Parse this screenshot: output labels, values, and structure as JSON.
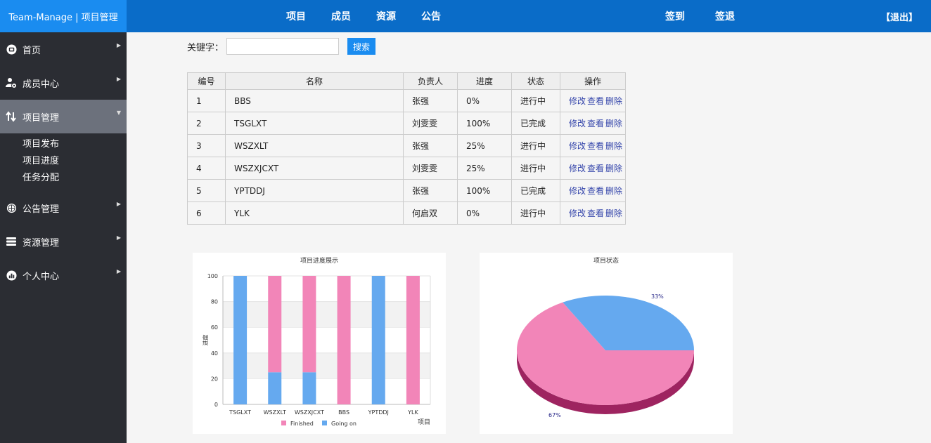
{
  "header": {
    "brand": "Team-Manage | 项目管理",
    "nav": [
      "项目",
      "成员",
      "资源",
      "公告"
    ],
    "sign_in": "签到",
    "sign_out": "签退",
    "logout": "【退出】"
  },
  "sidebar": {
    "items": [
      {
        "label": "首页",
        "icon": "home-icon"
      },
      {
        "label": "成员中心",
        "icon": "user-settings-icon"
      },
      {
        "label": "项目管理",
        "icon": "transfer-icon"
      },
      {
        "label": "公告管理",
        "icon": "globe-icon"
      },
      {
        "label": "资源管理",
        "icon": "stack-icon"
      },
      {
        "label": "个人中心",
        "icon": "chart-icon"
      }
    ],
    "submenu": [
      "项目发布",
      "项目进度",
      "任务分配"
    ]
  },
  "search": {
    "label": "关键字：",
    "placeholder": "",
    "value": "",
    "button": "搜索"
  },
  "table": {
    "headers": [
      "编号",
      "名称",
      "负责人",
      "进度",
      "状态",
      "操作"
    ],
    "rows": [
      [
        "1",
        "BBS",
        "张强",
        "0%",
        "进行中"
      ],
      [
        "2",
        "TSGLXT",
        "刘雯雯",
        "100%",
        "已完成"
      ],
      [
        "3",
        "WSZXLT",
        "张强",
        "25%",
        "进行中"
      ],
      [
        "4",
        "WSZXJCXT",
        "刘雯雯",
        "25%",
        "进行中"
      ],
      [
        "5",
        "YPTDDJ",
        "张强",
        "100%",
        "已完成"
      ],
      [
        "6",
        "YLK",
        "何启双",
        "0%",
        "进行中"
      ]
    ],
    "ops": [
      "修改",
      "查看",
      "删除"
    ]
  },
  "colors": {
    "finished": "#f285b8",
    "going_on": "#65a9ef",
    "pie_side": "#9e2460",
    "header_bg": "#0a6cc8",
    "brand_bg": "#1a8cf0",
    "sidebar_bg": "#2b2d33"
  },
  "chart_data": [
    {
      "type": "bar",
      "title": "项目进度展示",
      "xlabel": "项目",
      "ylabel": "进度",
      "ylim": [
        0,
        100
      ],
      "yticks": [
        "0",
        "20",
        "40",
        "60",
        "80",
        "100"
      ],
      "categories": [
        "TSGLXT",
        "WSZXLT",
        "WSZXJCXT",
        "BBS",
        "YPTDDJ",
        "YLK"
      ],
      "stacked": true,
      "series": [
        {
          "name": "Finished",
          "values": [
            0,
            75,
            75,
            100,
            0,
            100
          ]
        },
        {
          "name": "Going on",
          "values": [
            100,
            25,
            25,
            0,
            100,
            0
          ]
        }
      ],
      "legend": "bottom",
      "grid": true
    },
    {
      "type": "pie",
      "title": "项目状态",
      "slices": [
        {
          "label": "33%",
          "value": 33
        },
        {
          "label": "67%",
          "value": 67
        }
      ]
    }
  ]
}
